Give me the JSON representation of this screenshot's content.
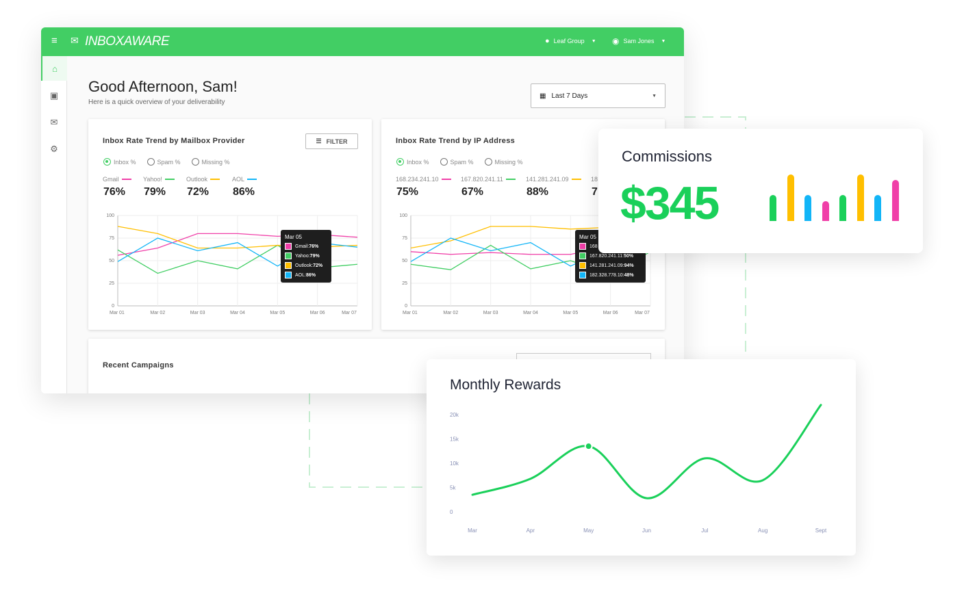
{
  "header": {
    "brand": "INBOXAWARE",
    "org": "Leaf Group",
    "user": "Sam Jones"
  },
  "sidebar": {
    "items": [
      {
        "icon": "home-icon"
      },
      {
        "icon": "inbox-icon"
      },
      {
        "icon": "mail-settings-icon"
      },
      {
        "icon": "gear-icon"
      }
    ]
  },
  "greeting": {
    "title": "Good Afternoon, Sam!",
    "subtitle": "Here is a quick overview of your deliverability"
  },
  "date_select": {
    "value": "Last 7 Days"
  },
  "colors": {
    "brand": "#42ce64",
    "pink": "#f03fa8",
    "green": "#42ce64",
    "yellow": "#ffbf00",
    "blue": "#12b5f7"
  },
  "radios": [
    "Inbox %",
    "Spam %",
    "Missing %"
  ],
  "filter_label": "FILTER",
  "recent_campaigns": "Recent Campaigns",
  "chart_data": [
    {
      "type": "line",
      "title": "Inbox Rate Trend by Mailbox Provider",
      "categories": [
        "Mar 01",
        "Mar 02",
        "Mar 03",
        "Mar 04",
        "Mar 05",
        "Mar 06",
        "Mar 07"
      ],
      "yticks": [
        "0",
        "25",
        "50",
        "75",
        "100"
      ],
      "ylim": [
        0,
        100
      ],
      "series": [
        {
          "name": "Gmail",
          "summary": "76%",
          "color": "#f03fa8",
          "values": [
            56,
            64,
            80,
            80,
            77,
            79,
            76
          ]
        },
        {
          "name": "Yahoo!",
          "summary": "79%",
          "color": "#42ce64",
          "values": [
            62,
            36,
            50,
            41,
            67,
            42,
            46
          ]
        },
        {
          "name": "Outlook",
          "summary": "72%",
          "color": "#ffbf00",
          "values": [
            88,
            80,
            64,
            64,
            67,
            65,
            67
          ]
        },
        {
          "name": "AOL",
          "summary": "86%",
          "color": "#12b5f7",
          "values": [
            49,
            75,
            61,
            70,
            44,
            70,
            65
          ]
        }
      ],
      "tooltip": {
        "title": "Mar 05",
        "rows": [
          {
            "label": "Gmail: ",
            "value": "76%"
          },
          {
            "label": "Yahoo: ",
            "value": "79%"
          },
          {
            "label": "Outlook: ",
            "value": "72%"
          },
          {
            "label": "AOL: ",
            "value": "86%"
          }
        ]
      }
    },
    {
      "type": "line",
      "title": "Inbox Rate Trend by IP Address",
      "categories": [
        "Mar 01",
        "Mar 02",
        "Mar 03",
        "Mar 04",
        "Mar 05",
        "Mar 06",
        "Mar 07"
      ],
      "yticks": [
        "0",
        "25",
        "50",
        "75",
        "100"
      ],
      "ylim": [
        0,
        100
      ],
      "series": [
        {
          "name": "168.234.241.10",
          "summary": "75%",
          "color": "#f03fa8",
          "values": [
            60,
            57,
            59,
            57,
            57,
            66,
            68
          ]
        },
        {
          "name": "167.820.241.11",
          "summary": "67%",
          "color": "#42ce64",
          "values": [
            46,
            40,
            67,
            41,
            50,
            35,
            60
          ]
        },
        {
          "name": "141.281.241.09",
          "summary": "88%",
          "color": "#ffbf00",
          "values": [
            64,
            72,
            88,
            88,
            85,
            87,
            88
          ]
        },
        {
          "name": "18",
          "summary": "7",
          "color": "#12b5f7",
          "values": [
            49,
            75,
            61,
            70,
            44,
            65,
            62
          ]
        }
      ],
      "tooltip": {
        "title": "Mar 05",
        "rows": [
          {
            "label": "168",
            "value": ""
          },
          {
            "label": "167.820.241.11: ",
            "value": "50%"
          },
          {
            "label": "141.281.241.09: ",
            "value": "94%"
          },
          {
            "label": "182.328.778.10: ",
            "value": "48%"
          }
        ]
      }
    },
    {
      "type": "bar",
      "title": "Commissions",
      "value": "$345",
      "values": [
        38,
        68,
        38,
        29,
        38,
        68,
        38,
        60
      ],
      "colors": [
        "#1ad05a",
        "#ffbf00",
        "#12b5f7",
        "#f03fa8",
        "#1ad05a",
        "#ffbf00",
        "#12b5f7",
        "#f03fa8"
      ]
    },
    {
      "type": "line",
      "title": "Monthly Rewards",
      "categories": [
        "Mar",
        "Apr",
        "May",
        "Jun",
        "Jul",
        "Aug",
        "Sept"
      ],
      "values": [
        3500,
        6800,
        13500,
        2800,
        11000,
        6500,
        22000
      ],
      "highlight": "May",
      "yticks": [
        "0",
        "5k",
        "10k",
        "15k",
        "20k"
      ],
      "ylim": [
        0,
        20000
      ],
      "color": "#1ad05a"
    }
  ]
}
